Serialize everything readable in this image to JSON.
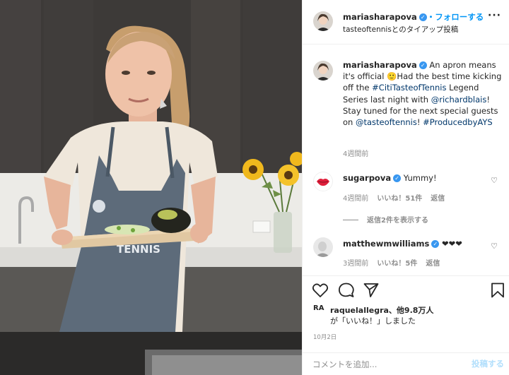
{
  "header": {
    "username": "mariasharapova",
    "follow_label": "・フォローする",
    "subtitle": "tasteoftennisとのタイアップ投稿",
    "more_label": "···"
  },
  "caption": {
    "username": "mariasharapova",
    "text_1": " An apron means it's official ",
    "emoji": "🙂",
    "text_2": "Had the best time kicking off the ",
    "hashtag_1": "#CitiTasteofTennis",
    "text_3": " Legend Series last night with ",
    "mention_1": "@richardblais",
    "text_4": "! Stay tuned for the next special guests on ",
    "mention_2": "@tasteoftennis",
    "text_5": "! ",
    "hashtag_2": "#ProducedbyAYS",
    "time": "4週間前"
  },
  "comments": [
    {
      "username": "sugarpova",
      "text": "Yummy!",
      "time": "4週間前",
      "likes": "いいね！51件",
      "reply": "返信"
    },
    {
      "username": "matthewmwilliams",
      "text": "❤❤❤",
      "time": "3週間前",
      "likes": "いいね！5件",
      "reply": "返信"
    }
  ],
  "view_replies": "返信2件を表示する",
  "likes": {
    "avatar_text": "RA",
    "line1": "raquelallegra、他9.8万人",
    "line2": "が「いいね！」しました"
  },
  "date": "10月2日",
  "add_comment": {
    "placeholder": "コメントを追加...",
    "post_label": "投稿する"
  },
  "colors": {
    "accent_blue": "#0095f6",
    "verified": "#3897f0",
    "link": "#00376b",
    "muted": "#8e8e8e"
  }
}
